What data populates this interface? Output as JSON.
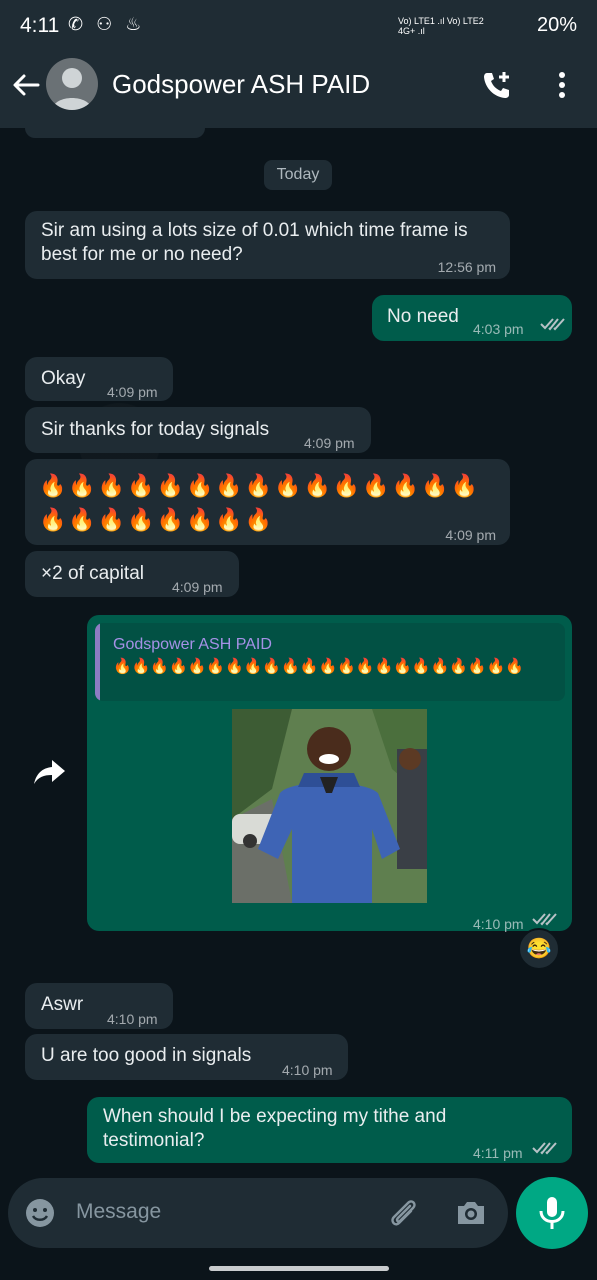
{
  "status_bar": {
    "time": "4:11",
    "notif_icons": "✆ ⚇ ♨",
    "network": "Vo) LTE1 .ıl Vo) LTE2 4G+ .ıl",
    "battery": "20%"
  },
  "header": {
    "contact_name": "Godspower ASH PAID"
  },
  "chat": {
    "date_chip": "Today",
    "messages": [
      {
        "dir": "in",
        "text": "Sir am using a lots size of 0.01 which time frame is best for me or no need?",
        "time": "12:56 pm"
      },
      {
        "dir": "out",
        "text": "No need",
        "time": "4:03 pm"
      },
      {
        "dir": "in",
        "text": "Okay",
        "time": "4:09 pm"
      },
      {
        "dir": "in",
        "text": "Sir thanks for today signals",
        "time": "4:09 pm"
      },
      {
        "dir": "in",
        "text": "🔥🔥🔥🔥🔥🔥🔥🔥🔥🔥🔥🔥🔥🔥🔥🔥🔥🔥🔥🔥🔥🔥🔥",
        "time": "4:09 pm"
      },
      {
        "dir": "in",
        "text": "×2 of capital",
        "time": "4:09 pm"
      },
      {
        "dir": "out",
        "quote_name": "Godspower ASH PAID",
        "quote_text": "🔥🔥🔥🔥🔥🔥🔥🔥🔥🔥🔥🔥🔥🔥🔥🔥🔥🔥🔥🔥🔥🔥",
        "time": "4:10 pm",
        "reaction": "😂"
      },
      {
        "dir": "in",
        "text": "Aswr",
        "time": "4:10 pm"
      },
      {
        "dir": "in",
        "text": "U are too good in signals",
        "time": "4:10 pm"
      },
      {
        "dir": "out",
        "text": "When should I be expecting my tithe and testimonial?",
        "time": "4:11 pm"
      }
    ]
  },
  "composer": {
    "placeholder": "Message"
  },
  "icons": {
    "back": "arrow-left-icon",
    "avatar": "person-icon",
    "add_call": "phone-plus-icon",
    "menu": "more-vert-icon",
    "forward": "forward-icon",
    "emoji": "emoji-icon",
    "attach": "paperclip-icon",
    "camera": "camera-icon",
    "mic": "mic-icon",
    "ticks": "double-check-icon"
  },
  "colors": {
    "background": "#0b141a",
    "incoming": "#1f2c34",
    "outgoing": "#005c4b",
    "accent": "#00a884"
  }
}
